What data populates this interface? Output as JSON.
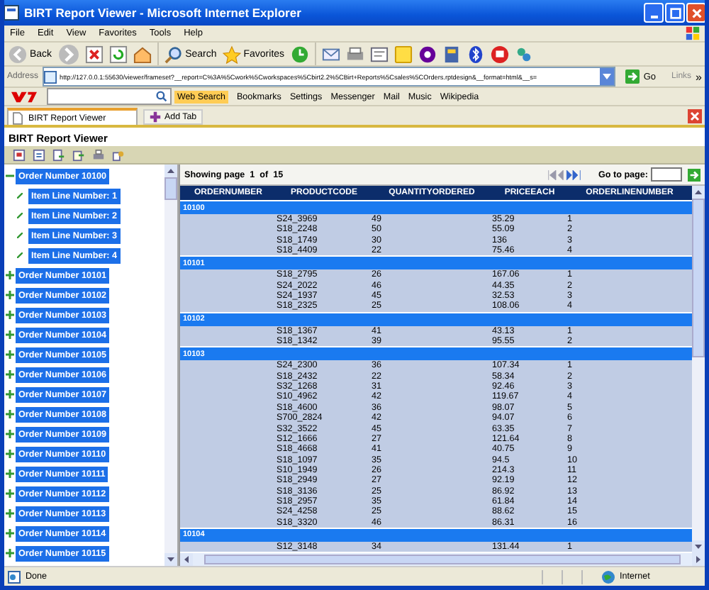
{
  "window": {
    "title": "BIRT Report Viewer - Microsoft Internet Explorer"
  },
  "menu": [
    "File",
    "Edit",
    "View",
    "Favorites",
    "Tools",
    "Help"
  ],
  "toolbar": {
    "back": "Back",
    "search": "Search",
    "favorites": "Favorites"
  },
  "address": {
    "label": "Address",
    "url": "http://127.0.0.1:55630/viewer/frameset?__report=C%3A%5Cwork%5Cworkspaces%5Cbirt2.2%5CBirt+Reports%5Csales%5COrders.rptdesign&__format=html&__s=",
    "go": "Go",
    "links": "Links",
    "more": "»"
  },
  "yahoo_bar": {
    "search_button": "Web Search",
    "items": [
      "Bookmarks",
      "Settings",
      "Messenger",
      "Mail",
      "Music",
      "Wikipedia"
    ]
  },
  "tabs": [
    {
      "label": "BIRT Report Viewer",
      "selected": true
    }
  ],
  "add_tab": "Add Tab",
  "report": {
    "title": "BIRT Report Viewer",
    "tree": [
      {
        "label": "Order Number 10100",
        "expanded": true,
        "children": [
          {
            "label": "Item Line Number: 1"
          },
          {
            "label": "Item Line Number: 2"
          },
          {
            "label": "Item Line Number: 3"
          },
          {
            "label": "Item Line Number: 4"
          }
        ]
      },
      {
        "label": "Order Number 10101",
        "expanded": false
      },
      {
        "label": "Order Number 10102",
        "expanded": false
      },
      {
        "label": "Order Number 10103",
        "expanded": false
      },
      {
        "label": "Order Number 10104",
        "expanded": false
      },
      {
        "label": "Order Number 10105",
        "expanded": false
      },
      {
        "label": "Order Number 10106",
        "expanded": false
      },
      {
        "label": "Order Number 10107",
        "expanded": false
      },
      {
        "label": "Order Number 10108",
        "expanded": false
      },
      {
        "label": "Order Number 10109",
        "expanded": false
      },
      {
        "label": "Order Number 10110",
        "expanded": false
      },
      {
        "label": "Order Number 10111",
        "expanded": false
      },
      {
        "label": "Order Number 10112",
        "expanded": false
      },
      {
        "label": "Order Number 10113",
        "expanded": false
      },
      {
        "label": "Order Number 10114",
        "expanded": false
      },
      {
        "label": "Order Number 10115",
        "expanded": false
      }
    ],
    "pager": {
      "showing": "Showing page",
      "page": "1",
      "of": "of",
      "total": "15",
      "goto": "Go to page:"
    },
    "table": {
      "columns": [
        "ORDERNUMBER",
        "PRODUCTCODE",
        "QUANTITYORDERED",
        "PRICEEACH",
        "ORDERLINENUMBER"
      ],
      "groups": [
        {
          "order": "10100",
          "rows": [
            [
              "S24_3969",
              "49",
              "35.29",
              "1"
            ],
            [
              "S18_2248",
              "50",
              "55.09",
              "2"
            ],
            [
              "S18_1749",
              "30",
              "136",
              "3"
            ],
            [
              "S18_4409",
              "22",
              "75.46",
              "4"
            ]
          ]
        },
        {
          "order": "10101",
          "rows": [
            [
              "S18_2795",
              "26",
              "167.06",
              "1"
            ],
            [
              "S24_2022",
              "46",
              "44.35",
              "2"
            ],
            [
              "S24_1937",
              "45",
              "32.53",
              "3"
            ],
            [
              "S18_2325",
              "25",
              "108.06",
              "4"
            ]
          ]
        },
        {
          "order": "10102",
          "rows": [
            [
              "S18_1367",
              "41",
              "43.13",
              "1"
            ],
            [
              "S18_1342",
              "39",
              "95.55",
              "2"
            ]
          ]
        },
        {
          "order": "10103",
          "rows": [
            [
              "S24_2300",
              "36",
              "107.34",
              "1"
            ],
            [
              "S18_2432",
              "22",
              "58.34",
              "2"
            ],
            [
              "S32_1268",
              "31",
              "92.46",
              "3"
            ],
            [
              "S10_4962",
              "42",
              "119.67",
              "4"
            ],
            [
              "S18_4600",
              "36",
              "98.07",
              "5"
            ],
            [
              "S700_2824",
              "42",
              "94.07",
              "6"
            ],
            [
              "S32_3522",
              "45",
              "63.35",
              "7"
            ],
            [
              "S12_1666",
              "27",
              "121.64",
              "8"
            ],
            [
              "S18_4668",
              "41",
              "40.75",
              "9"
            ],
            [
              "S18_1097",
              "35",
              "94.5",
              "10"
            ],
            [
              "S10_1949",
              "26",
              "214.3",
              "11"
            ],
            [
              "S18_2949",
              "27",
              "92.19",
              "12"
            ],
            [
              "S18_3136",
              "25",
              "86.92",
              "13"
            ],
            [
              "S18_2957",
              "35",
              "61.84",
              "14"
            ],
            [
              "S24_4258",
              "25",
              "88.62",
              "15"
            ],
            [
              "S18_3320",
              "46",
              "86.31",
              "16"
            ]
          ]
        },
        {
          "order": "10104",
          "rows": [
            [
              "S12_3148",
              "34",
              "131.44",
              "1"
            ]
          ]
        }
      ]
    }
  },
  "status": {
    "text": "Done",
    "zone": "Internet"
  }
}
